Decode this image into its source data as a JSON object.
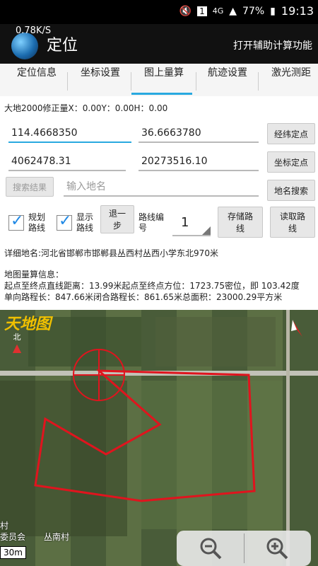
{
  "status": {
    "battery": "77%",
    "time": "19:13",
    "network": "4G",
    "sim": "1"
  },
  "app": {
    "speed": "0.78K/S",
    "title": "定位",
    "assist": "打开辅助计算功能"
  },
  "tabs": [
    {
      "label": "定位信息"
    },
    {
      "label": "坐标设置"
    },
    {
      "label": "图上量算"
    },
    {
      "label": "航迹设置"
    },
    {
      "label": "激光测距"
    }
  ],
  "correction": "大地2000修正量X：0.00Y：0.00H：0.00",
  "coords": {
    "lng": "114.4668350",
    "lat": "36.6663780",
    "x": "4062478.31",
    "y": "20273516.10",
    "lnglat_btn": "经纬定点",
    "xy_btn": "坐标定点"
  },
  "search": {
    "result_btn": "搜索结果",
    "placeholder": "输入地名",
    "search_btn": "地名搜索"
  },
  "route": {
    "plan_label": "规划\n路线",
    "show_label": "显示\n路线",
    "back_btn": "退一\n步",
    "num_label": "路线编\n号",
    "num_value": "1",
    "save_btn": "存储路\n线",
    "read_btn": "读取路\n线"
  },
  "address": "详细地名:河北省邯郸市邯郸县丛西村丛西小学东北970米",
  "measure": {
    "heading": "地图量算信息：",
    "line1": "起点至终点直线距离：13.99米起点至终点方位：1723.75密位，即 103.42度",
    "line2": "单向路程长：847.66米闭合路程长：861.65米总面积：23000.29平方米"
  },
  "map": {
    "logo": "天地图",
    "north": "北",
    "place1": "丛南村",
    "place2": "村",
    "place3": "委员会",
    "scale": "30m"
  },
  "colors": {
    "accent": "#29a9e0",
    "route": "#e0141e"
  }
}
